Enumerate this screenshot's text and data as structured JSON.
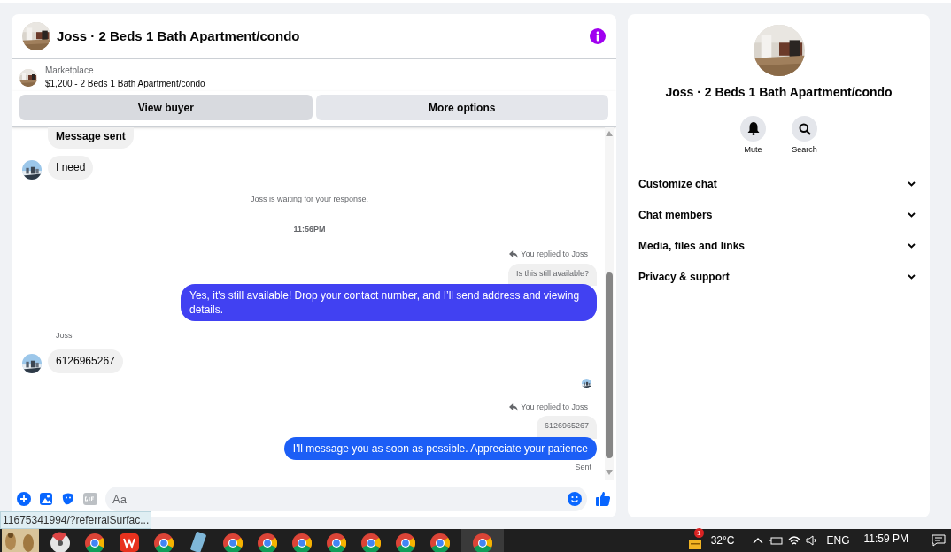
{
  "chat": {
    "title": "Joss · 2 Beds 1 Bath Apartment/condo",
    "listing": {
      "source": "Marketplace",
      "summary": "$1,200 - 2 Beds 1 Bath Apartment/condo"
    },
    "actions": [
      {
        "label": "View buyer",
        "selected": true
      },
      {
        "label": "More options",
        "selected": false
      }
    ],
    "messages": [
      {
        "kind": "incoming",
        "text": "Message sent",
        "bold": true,
        "avatar": false,
        "cut": true
      },
      {
        "kind": "incoming",
        "text": "I need",
        "bold": false,
        "avatar": true,
        "cut": false
      },
      {
        "kind": "notice",
        "text": "Joss is waiting for your response."
      },
      {
        "kind": "time",
        "text": "11:56PM"
      },
      {
        "kind": "reply_label",
        "text": "You replied to Joss"
      },
      {
        "kind": "quote",
        "text": "Is this still available?"
      },
      {
        "kind": "outgoing",
        "text": "Yes, it's still available! Drop your contact number, and I’ll send address and viewing details.",
        "color": "#4141f2"
      },
      {
        "kind": "sender",
        "text": "Joss"
      },
      {
        "kind": "incoming",
        "text": "6126965267",
        "bold": false,
        "avatar": true,
        "cut": false
      },
      {
        "kind": "seen"
      },
      {
        "kind": "reply_label",
        "text": "You replied to Joss"
      },
      {
        "kind": "quote",
        "text": "6126965267"
      },
      {
        "kind": "outgoing",
        "text": "I'll message you as soon as possible. Appreciate your patience",
        "color": "#1c5ef6"
      },
      {
        "kind": "status",
        "text": "Sent"
      }
    ],
    "composer": {
      "placeholder": "Aa"
    }
  },
  "info": {
    "title": "Joss · 2 Beds 1 Bath Apartment/condo",
    "buttons": [
      {
        "kind": "bell",
        "label": "Mute"
      },
      {
        "kind": "search",
        "label": "Search"
      }
    ],
    "sections": [
      {
        "label": "Customize chat",
        "expanded": false
      },
      {
        "label": "Chat members",
        "expanded": false
      },
      {
        "label": "Media, files and links",
        "expanded": false
      },
      {
        "label": "Privacy & support",
        "expanded": false
      }
    ]
  },
  "link_preview": "11675341994/?referralSurfac...",
  "taskbar": {
    "apps": [
      {
        "kind": "meerkat",
        "selected": false
      },
      {
        "kind": "disc",
        "selected": false
      },
      {
        "kind": "chrome",
        "selected": false
      },
      {
        "kind": "office",
        "selected": false
      },
      {
        "kind": "chrome",
        "selected": false
      },
      {
        "kind": "phone",
        "selected": false
      },
      {
        "kind": "chrome",
        "selected": false
      },
      {
        "kind": "chrome",
        "selected": false
      },
      {
        "kind": "chrome",
        "selected": false
      },
      {
        "kind": "chrome",
        "selected": false
      },
      {
        "kind": "chrome",
        "selected": false
      },
      {
        "kind": "chrome",
        "selected": false
      },
      {
        "kind": "chrome",
        "selected": false
      },
      {
        "kind": "chrome",
        "selected": true
      }
    ],
    "weather_badge": "1",
    "temperature": "32°C",
    "language": "ENG",
    "time": "11:59 PM"
  }
}
